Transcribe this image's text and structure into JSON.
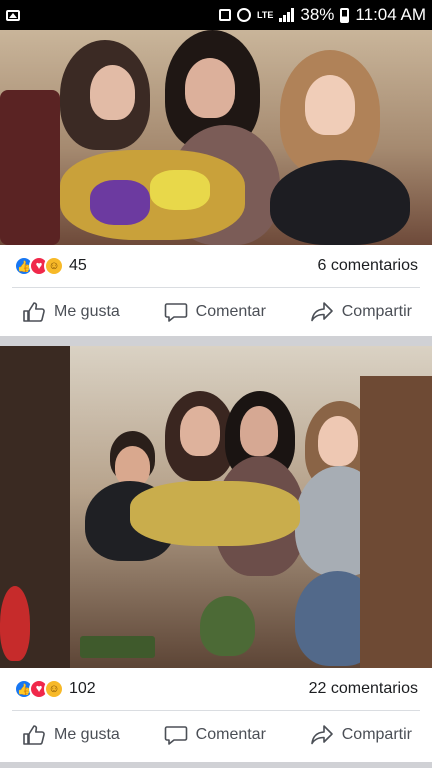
{
  "status_bar": {
    "network_label": "LTE",
    "battery": "38%",
    "time": "11:04 AM",
    "icons": [
      "image-icon",
      "lock-icon",
      "alarm-icon",
      "signal-icon",
      "battery-icon"
    ]
  },
  "posts": [
    {
      "photo_label": "family photo with flowers",
      "reaction_count": "45",
      "comment_count": "6 comentarios",
      "actions": {
        "like": "Me gusta",
        "comment": "Comentar",
        "share": "Compartir"
      }
    },
    {
      "photo_label": "family photo on sofa",
      "reaction_count": "102",
      "comment_count": "22 comentarios",
      "actions": {
        "like": "Me gusta",
        "comment": "Comentar",
        "share": "Compartir"
      }
    }
  ],
  "colors": {
    "like_reaction": "#1877f2",
    "love_reaction": "#f0284a",
    "care_reaction": "#f7b928",
    "action_text": "#4b4f56",
    "feed_background": "#d0d1d5"
  }
}
